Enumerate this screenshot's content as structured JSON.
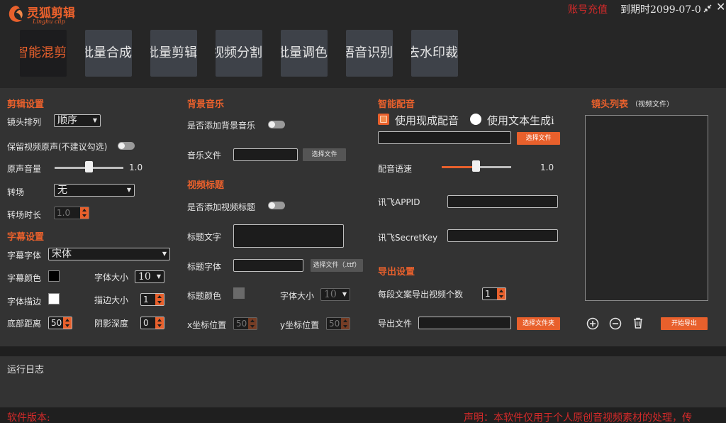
{
  "app": {
    "logo_title": "灵狐剪辑",
    "logo_subtitle": "Linghu clip",
    "recharge": "账号充值",
    "expiry": "到期时2099-07-0",
    "accent": "#e8602c",
    "warn": "#d42a2a"
  },
  "tabs": [
    {
      "label": "智能混剪"
    },
    {
      "label": "批量合成"
    },
    {
      "label": "批量剪辑"
    },
    {
      "label": "视频分割"
    },
    {
      "label": "批量调色"
    },
    {
      "label": "语音识别"
    },
    {
      "label": "去水印裁剪"
    }
  ],
  "edit": {
    "section": "剪辑设置",
    "order_label": "镜头排列",
    "order_value": "顺序",
    "keep_audio_label": "保留视频原声(不建议勾选)",
    "volume_label": "原声音量",
    "volume_value": "1.0",
    "volume_level": 0.5,
    "transition_label": "转场",
    "transition_value": "无",
    "transition_duration_label": "转场时长",
    "transition_duration_value": "1.0"
  },
  "subtitle": {
    "section": "字幕设置",
    "font_label": "字幕字体",
    "font_value": "宋体",
    "color_label": "字幕颜色",
    "font_size_label": "字体大小",
    "font_size_value": "10",
    "stroke_label": "字体描边",
    "stroke_size_label": "描边大小",
    "stroke_size_value": "1",
    "bottom_label": "底部距离",
    "bottom_value": "50",
    "shadow_label": "阴影深度",
    "shadow_value": "0"
  },
  "music": {
    "section": "背景音乐",
    "add_label": "是否添加背景音乐",
    "file_label": "音乐文件",
    "choose_label": "选择文件"
  },
  "title": {
    "section": "视频标题",
    "add_label": "是否添加视频标题",
    "text_label": "标题文字",
    "font_label": "标题字体",
    "choose_font_label": "选择文件（.ttf）",
    "color_label": "标题颜色",
    "font_size_label": "字体大小",
    "font_size_value": "10",
    "x_label": "x坐标位置",
    "x_value": "50",
    "y_label": "y坐标位置",
    "y_value": "50"
  },
  "voice": {
    "section": "智能配音",
    "existing_label": "使用现成配音",
    "tts_label": "使用文本生成i",
    "choose_label": "选择文件",
    "speed_label": "配音语速",
    "speed_value": "1.0",
    "speed_level": 0.5,
    "appid_label": "讯飞APPID",
    "secret_label": "讯飞SecretKey"
  },
  "export": {
    "section": "导出设置",
    "count_label": "每段文案导出视频个数",
    "count_value": "1",
    "file_label": "导出文件",
    "choose_label": "选择文件夹"
  },
  "shots": {
    "title": "镜头列表",
    "subtitle": "（视频文件）",
    "start_label": "开始导出"
  },
  "log": {
    "title": "运行日志"
  },
  "footer": {
    "version": "软件版本:",
    "notice": "声明：本软件仅用于个人原创音视频素材的处理，传"
  }
}
